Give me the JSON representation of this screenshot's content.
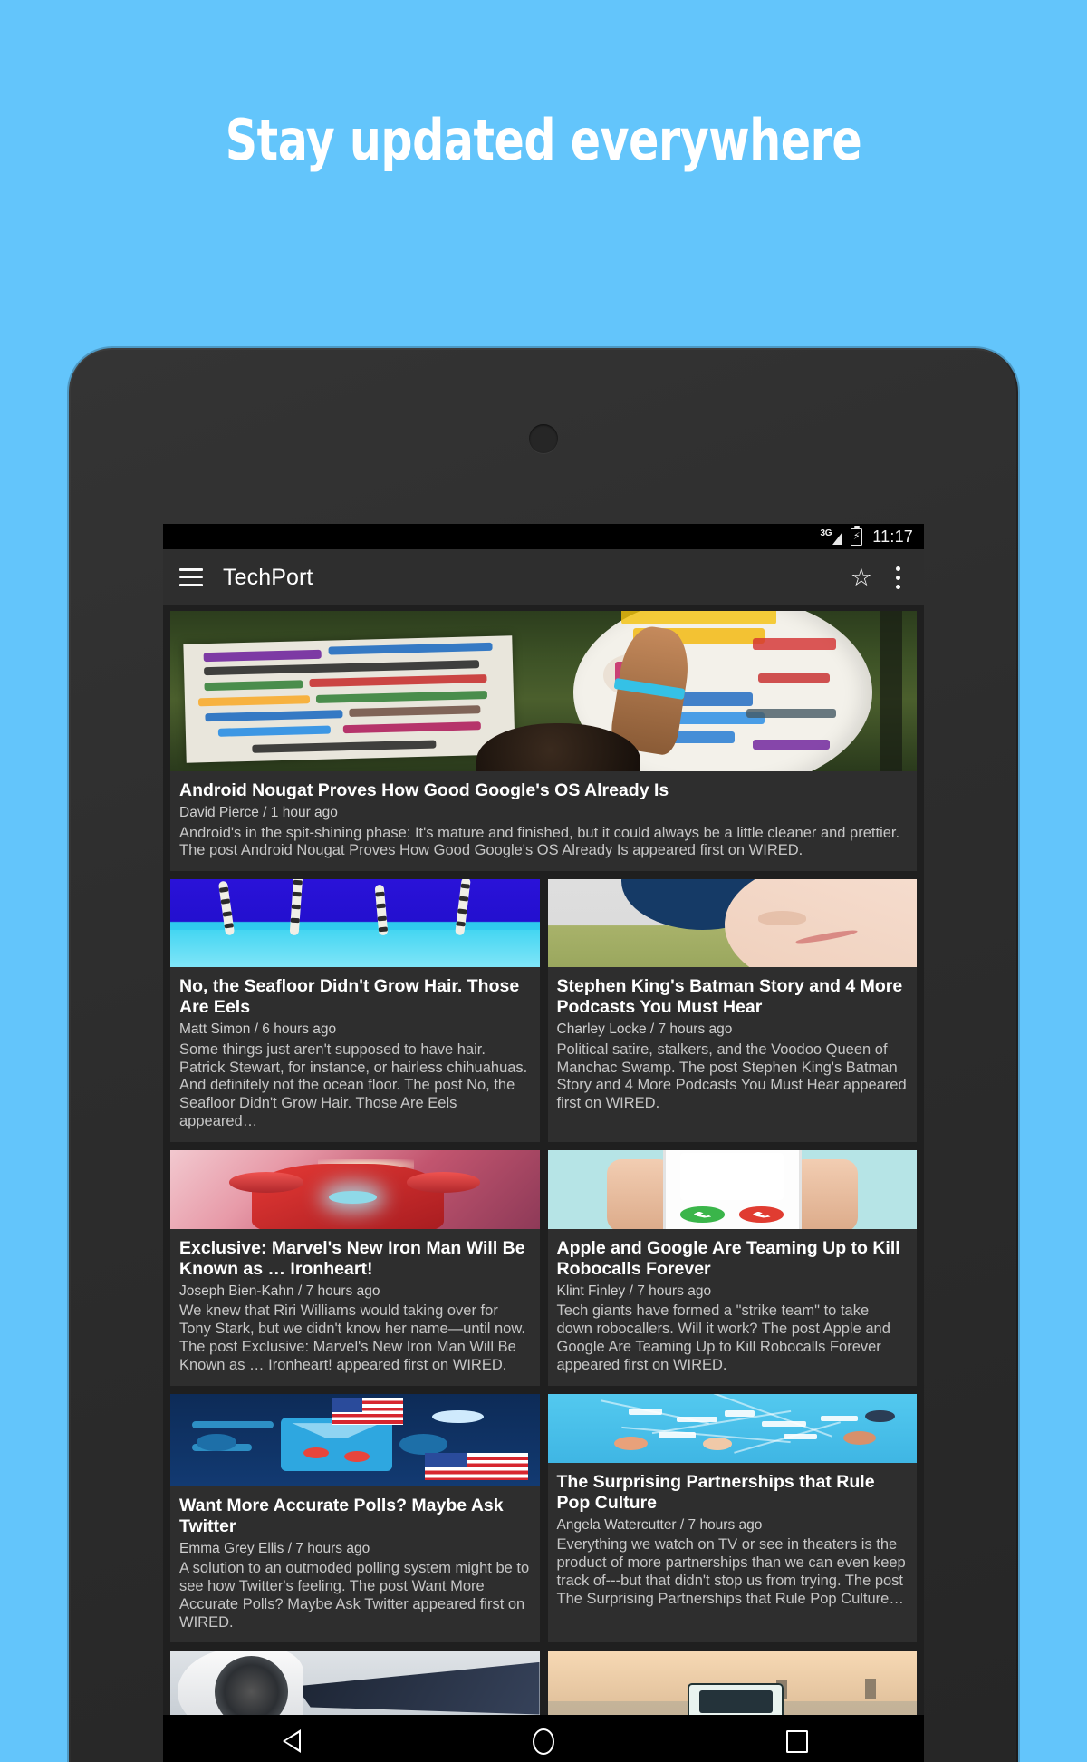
{
  "promo": {
    "headline": "Stay updated everywhere",
    "background_color": "#63c5fb",
    "headline_color": "#ffffff"
  },
  "device": {
    "body_color": "#2e2e2e",
    "screen_background": "#1f1f1f"
  },
  "status_bar": {
    "network": "3G",
    "battery_state": "charging",
    "clock": "11:17",
    "background_color": "#000000"
  },
  "app_bar": {
    "menu_icon": "hamburger-menu-icon",
    "title": "TechPort",
    "star_icon": "star-outline-icon",
    "star_glyph": "☆",
    "overflow_icon": "more-vertical-icon",
    "background_color": "#2e2e2e"
  },
  "feed": {
    "rows": [
      {
        "layout": "full",
        "cards": [
          {
            "title": "Android Nougat Proves How Good Google's OS Already Is",
            "meta": "David Pierce / 1 hour ago",
            "excerpt": "Android's in the spit-shining phase: It's mature and finished, but it could always be a little cleaner and prettier. The post Android Nougat Proves How Good Google's OS Already Is appeared first on WIRED.",
            "thumb_name": "thumbnail-android-nougat-statue"
          }
        ]
      },
      {
        "layout": "half",
        "cards": [
          {
            "title": "No, the Seafloor Didn't Grow Hair. Those Are Eels",
            "meta": "Matt Simon / 6 hours ago",
            "excerpt": "Some things just aren't supposed to have hair. Patrick Stewart, for instance, or hairless chihuahuas. And definitely not the ocean floor. The post No, the Seafloor Didn't Grow Hair. Those Are Eels appeared…",
            "thumb_name": "thumbnail-seafloor-eels"
          },
          {
            "title": "Stephen King's Batman Story and 4 More Podcasts You Must Hear",
            "meta": "Charley Locke / 7 hours ago",
            "excerpt": "Political satire, stalkers, and the Voodoo Queen of Manchac Swamp. The post Stephen King's Batman Story and 4 More Podcasts You Must Hear appeared first on WIRED.",
            "thumb_name": "thumbnail-podcasts-face"
          }
        ]
      },
      {
        "layout": "half",
        "cards": [
          {
            "title": "Exclusive: Marvel's New Iron Man Will Be Known as … Ironheart!",
            "meta": "Joseph Bien-Kahn / 7 hours ago",
            "excerpt": "We knew that Riri Williams would taking over for Tony Stark, but we didn't know her name—until now. The post Exclusive: Marvel's New Iron Man Will Be Known as … Ironheart! appeared first on WIRED.",
            "thumb_name": "thumbnail-ironheart-armor"
          },
          {
            "title": "Apple and Google Are Teaming Up to Kill Robocalls Forever",
            "meta": "Klint Finley / 7 hours ago",
            "excerpt": "Tech giants have formed a \"strike team\" to take down robocallers. Will it work? The post Apple and Google Are Teaming Up to Kill Robocalls Forever appeared first on WIRED.",
            "thumb_name": "thumbnail-robocall-phone"
          }
        ]
      },
      {
        "layout": "half",
        "cards": [
          {
            "title": "Want More Accurate Polls? Maybe Ask Twitter",
            "meta": "Emma Grey Ellis / 7 hours ago",
            "excerpt": "A solution to an outmoded polling system might be to see how Twitter's feeling. The post Want More Accurate Polls? Maybe Ask Twitter appeared first on WIRED.",
            "thumb_name": "thumbnail-polling-machine"
          },
          {
            "title": "The Surprising Partnerships that Rule Pop Culture",
            "meta": "Angela Watercutter / 7 hours ago",
            "excerpt": "Everything we watch on TV or see in theaters is the product of more partnerships than we can even keep track of---but that didn't stop us from trying. The post The Surprising Partnerships that Rule Pop Culture…",
            "thumb_name": "thumbnail-pop-culture-map"
          }
        ]
      },
      {
        "layout": "half-partial",
        "cards": [
          {
            "title": "",
            "meta": "",
            "excerpt": "",
            "thumb_name": "thumbnail-jet-engine"
          },
          {
            "title": "",
            "meta": "",
            "excerpt": "",
            "thumb_name": "thumbnail-expedition-truck"
          }
        ]
      }
    ]
  },
  "nav_bar": {
    "back_icon": "back-triangle-icon",
    "home_icon": "home-circle-icon",
    "recents_icon": "recents-square-icon",
    "background_color": "#000000"
  }
}
